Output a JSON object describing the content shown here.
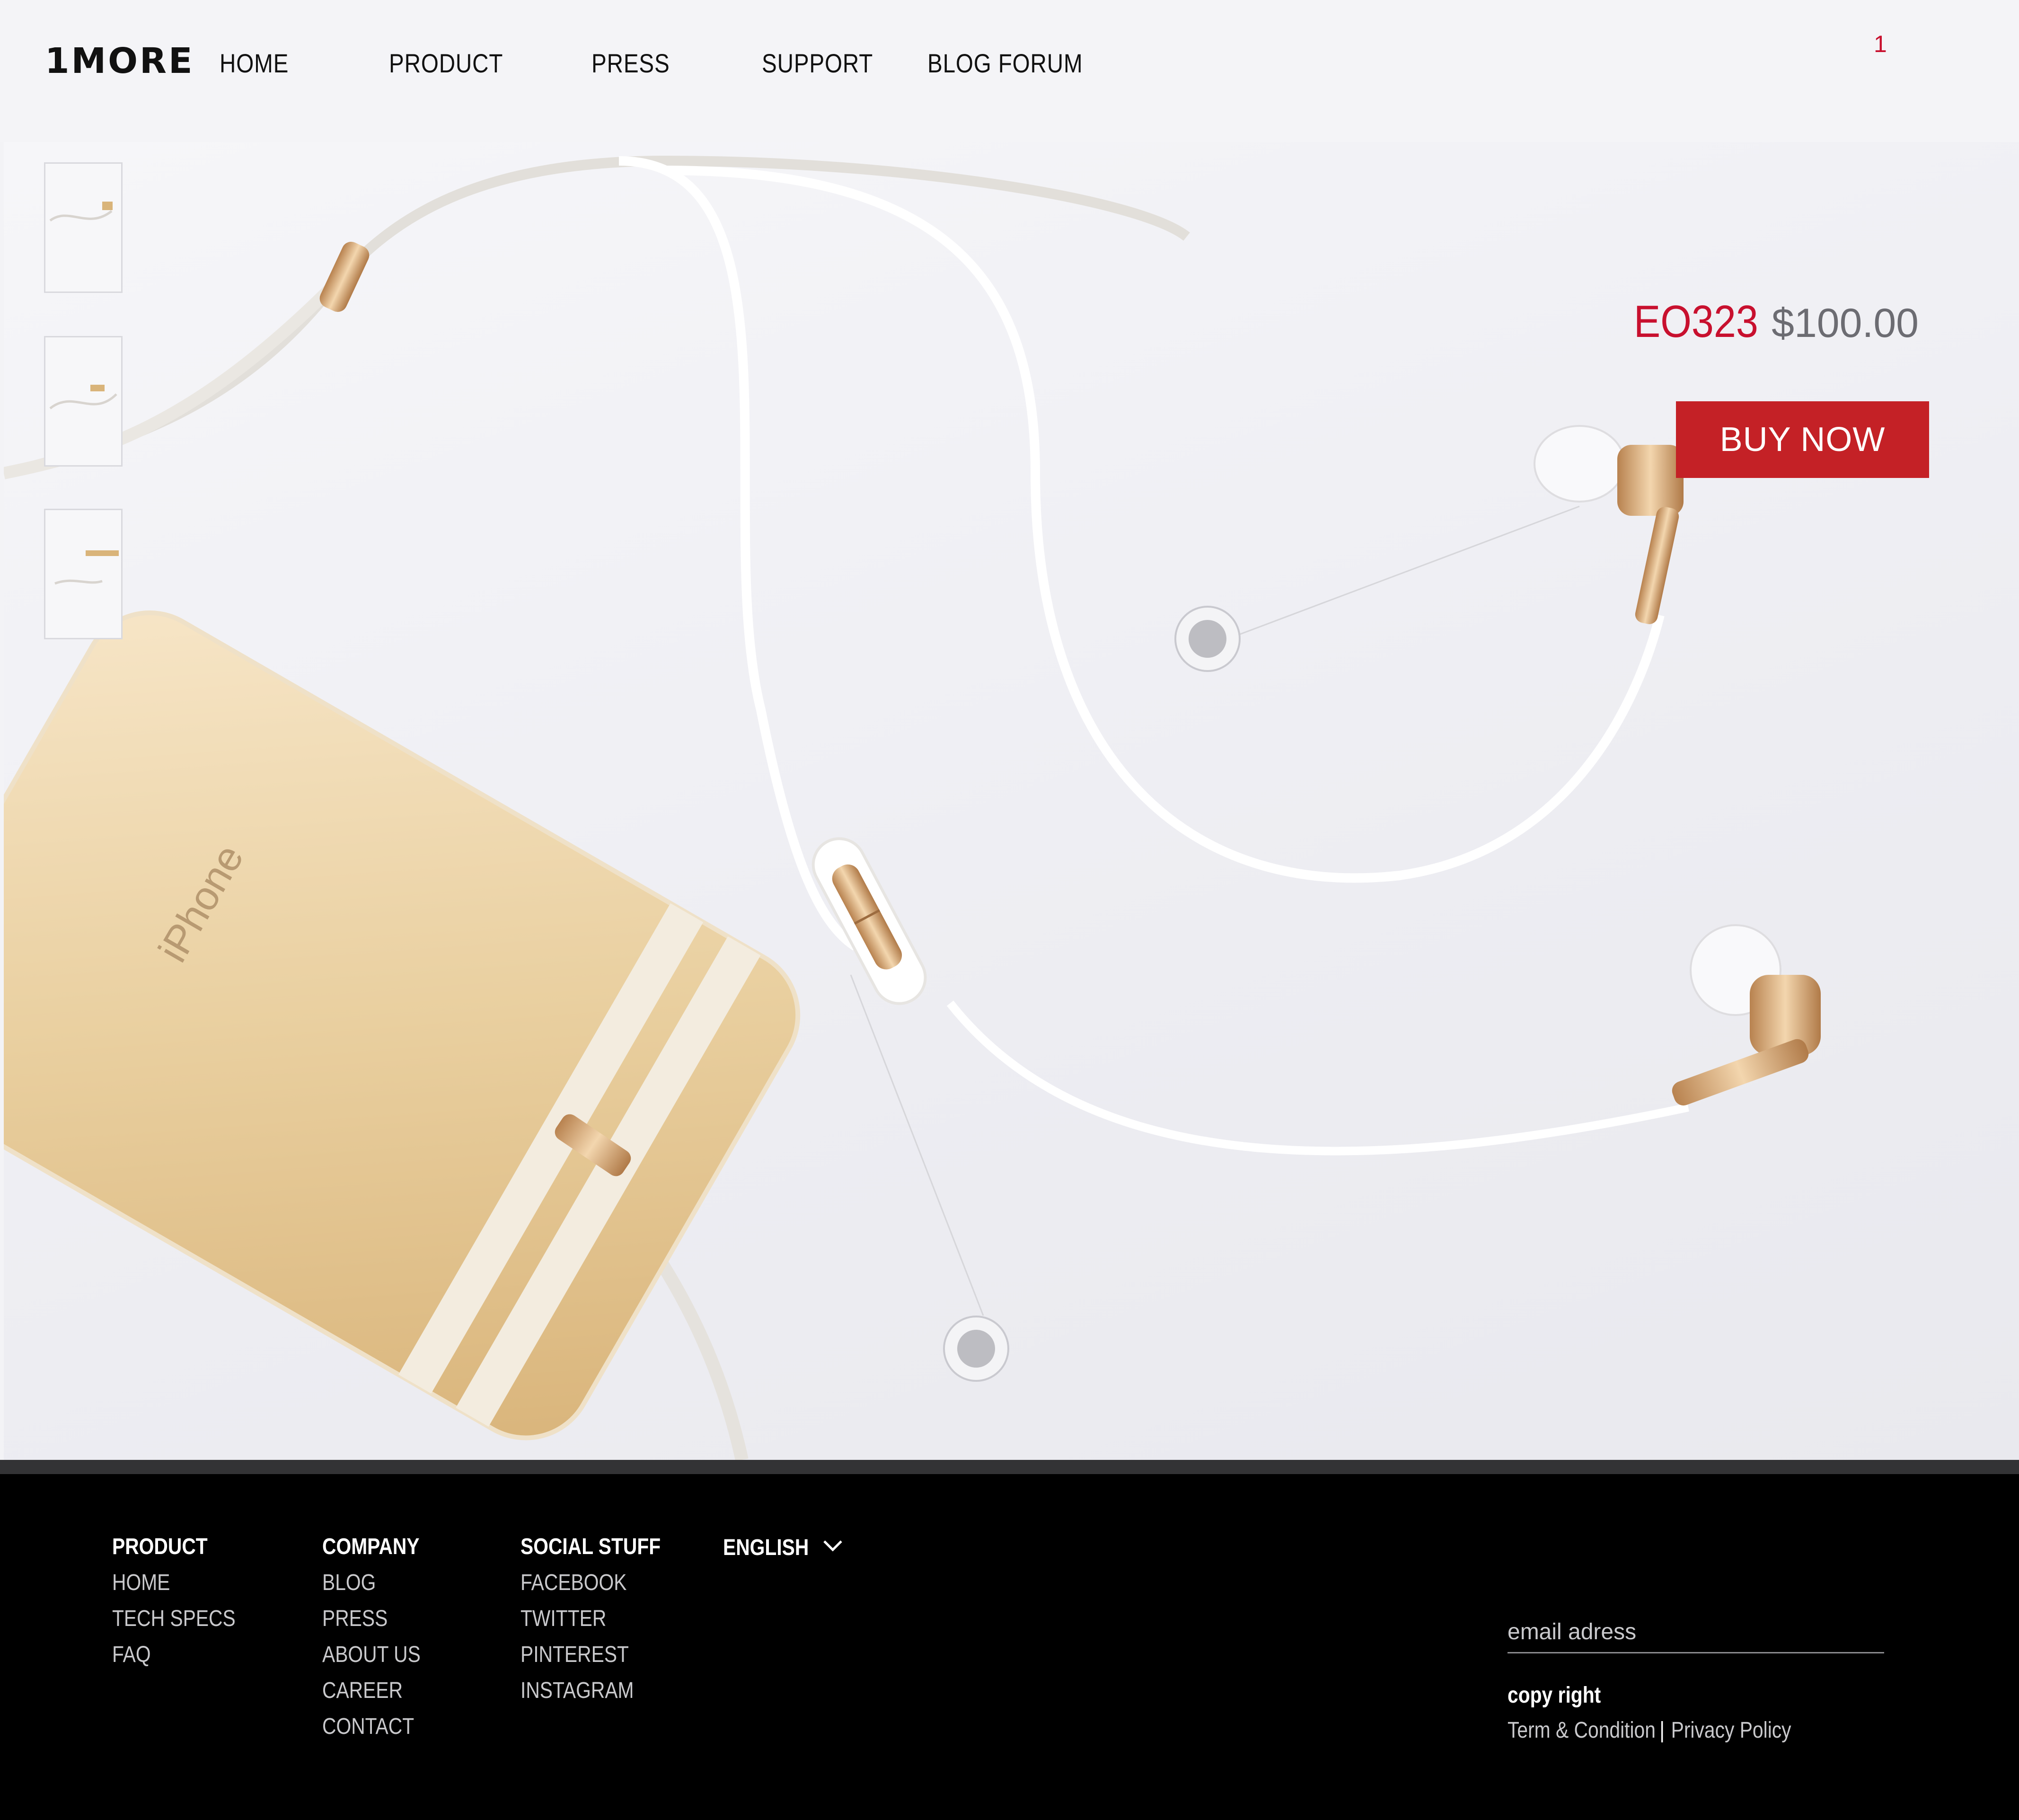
{
  "header": {
    "logo": "1MORE",
    "nav": [
      "HOME",
      "PRODUCT",
      "PRESS",
      "SUPPORT",
      "BLOG FORUM"
    ],
    "cart_count": "1"
  },
  "product": {
    "model": "EO323",
    "price": "$100.00",
    "buy_label": "BUY NOW",
    "phone_brand_text": "iPhone"
  },
  "footer": {
    "columns": [
      {
        "heading": "PRODUCT",
        "links": [
          "HOME",
          "TECH SPECS",
          "FAQ"
        ]
      },
      {
        "heading": "COMPANY",
        "links": [
          "BLOG",
          "PRESS",
          "ABOUT US",
          "CAREER",
          "CONTACT"
        ]
      },
      {
        "heading": "SOCIAL STUFF",
        "links": [
          "FACEBOOK",
          "TWITTER",
          "PINTEREST",
          "INSTAGRAM"
        ]
      }
    ],
    "language": "ENGLISH",
    "email_placeholder": "email adress",
    "copyright": "copy right",
    "terms": "Term & Condition",
    "separator": "|",
    "privacy": "Privacy Policy"
  },
  "colors": {
    "accent_red": "#c42126",
    "model_red": "#c8102e",
    "footer_bg": "#000000"
  },
  "icons": [
    "chevron-down-icon",
    "hotspot-icon"
  ]
}
